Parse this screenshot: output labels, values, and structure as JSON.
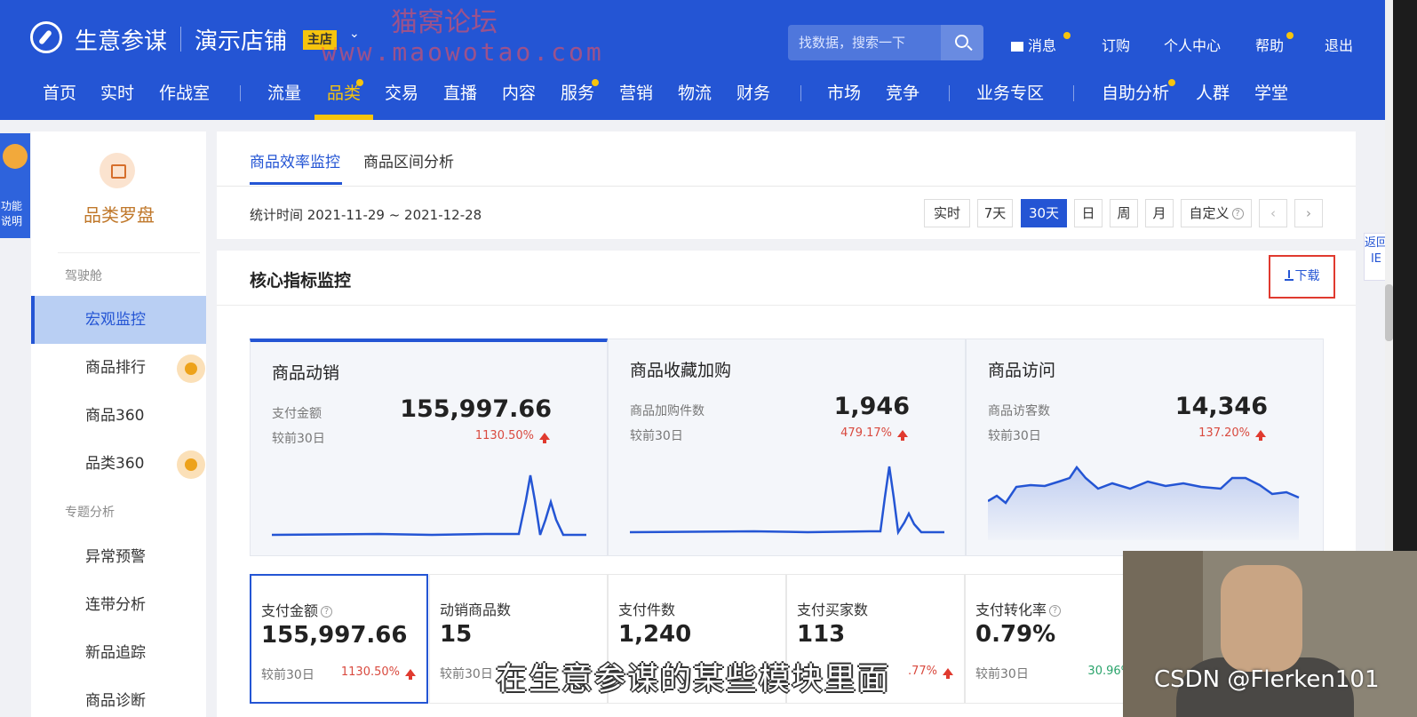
{
  "header": {
    "brand": "生意参谋",
    "shop_name": "演示店铺",
    "shop_badge": "主店",
    "watermark": "猫窝论坛",
    "watermark_url": "www.maowotao.com",
    "search_placeholder": "找数据，搜索一下",
    "utils": [
      "消息",
      "订购",
      "个人中心",
      "帮助",
      "退出"
    ]
  },
  "nav": {
    "items": [
      "首页",
      "实时",
      "作战室",
      "流量",
      "品类",
      "交易",
      "直播",
      "内容",
      "服务",
      "营销",
      "物流",
      "财务",
      "市场",
      "竞争",
      "业务专区",
      "自助分析",
      "人群",
      "学堂"
    ],
    "active": "品类"
  },
  "mascot": {
    "label": "功能说明"
  },
  "sidebar": {
    "title": "品类罗盘",
    "group1": "驾驶舱",
    "group2": "专题分析",
    "items": [
      "宏观监控",
      "商品排行",
      "商品360",
      "品类360",
      "异常预警",
      "连带分析",
      "新品追踪",
      "商品诊断"
    ]
  },
  "tabs": {
    "items": [
      "商品效率监控",
      "商品区间分析"
    ],
    "stat_time": "统计时间 2021-11-29 ~ 2021-12-28",
    "time_buttons": [
      "实时",
      "7天",
      "30天",
      "日",
      "周",
      "月",
      "自定义"
    ],
    "active_time": "30天",
    "prev": "‹",
    "next": "›"
  },
  "core": {
    "title": "核心指标监控",
    "download": "下载",
    "cards": [
      {
        "title": "商品动销",
        "label": "支付金额",
        "value": "155,997.66",
        "compare": "较前30日",
        "change": "1130.50%"
      },
      {
        "title": "商品收藏加购",
        "label": "商品加购件数",
        "value": "1,946",
        "compare": "较前30日",
        "change": "479.17%"
      },
      {
        "title": "商品访问",
        "label": "商品访客数",
        "value": "14,346",
        "compare": "较前30日",
        "change": "137.20%"
      }
    ],
    "kpis": [
      {
        "label": "支付金额",
        "value": "155,997.66",
        "compare": "较前30日",
        "change": "1130.50%",
        "help": "?"
      },
      {
        "label": "动销商品数",
        "value": "15",
        "compare": "较前30日",
        "change": ""
      },
      {
        "label": "支付件数",
        "value": "1,240",
        "compare": "",
        "change": ""
      },
      {
        "label": "支付买家数",
        "value": "113",
        "compare": "",
        "change": ".77%"
      },
      {
        "label": "支付转化率",
        "value": "0.79%",
        "compare": "较前30日",
        "change": "30.96%",
        "help": "?"
      }
    ]
  },
  "overlay": {
    "subtitle": "在生意参谋的某些模块里面",
    "csdn": "CSDN @Flerken101",
    "right_float": "返回IE"
  },
  "colors": {
    "primary": "#2455d4",
    "accent": "#f6c40d",
    "up": "#e03a2f",
    "green": "#2aa36b"
  }
}
